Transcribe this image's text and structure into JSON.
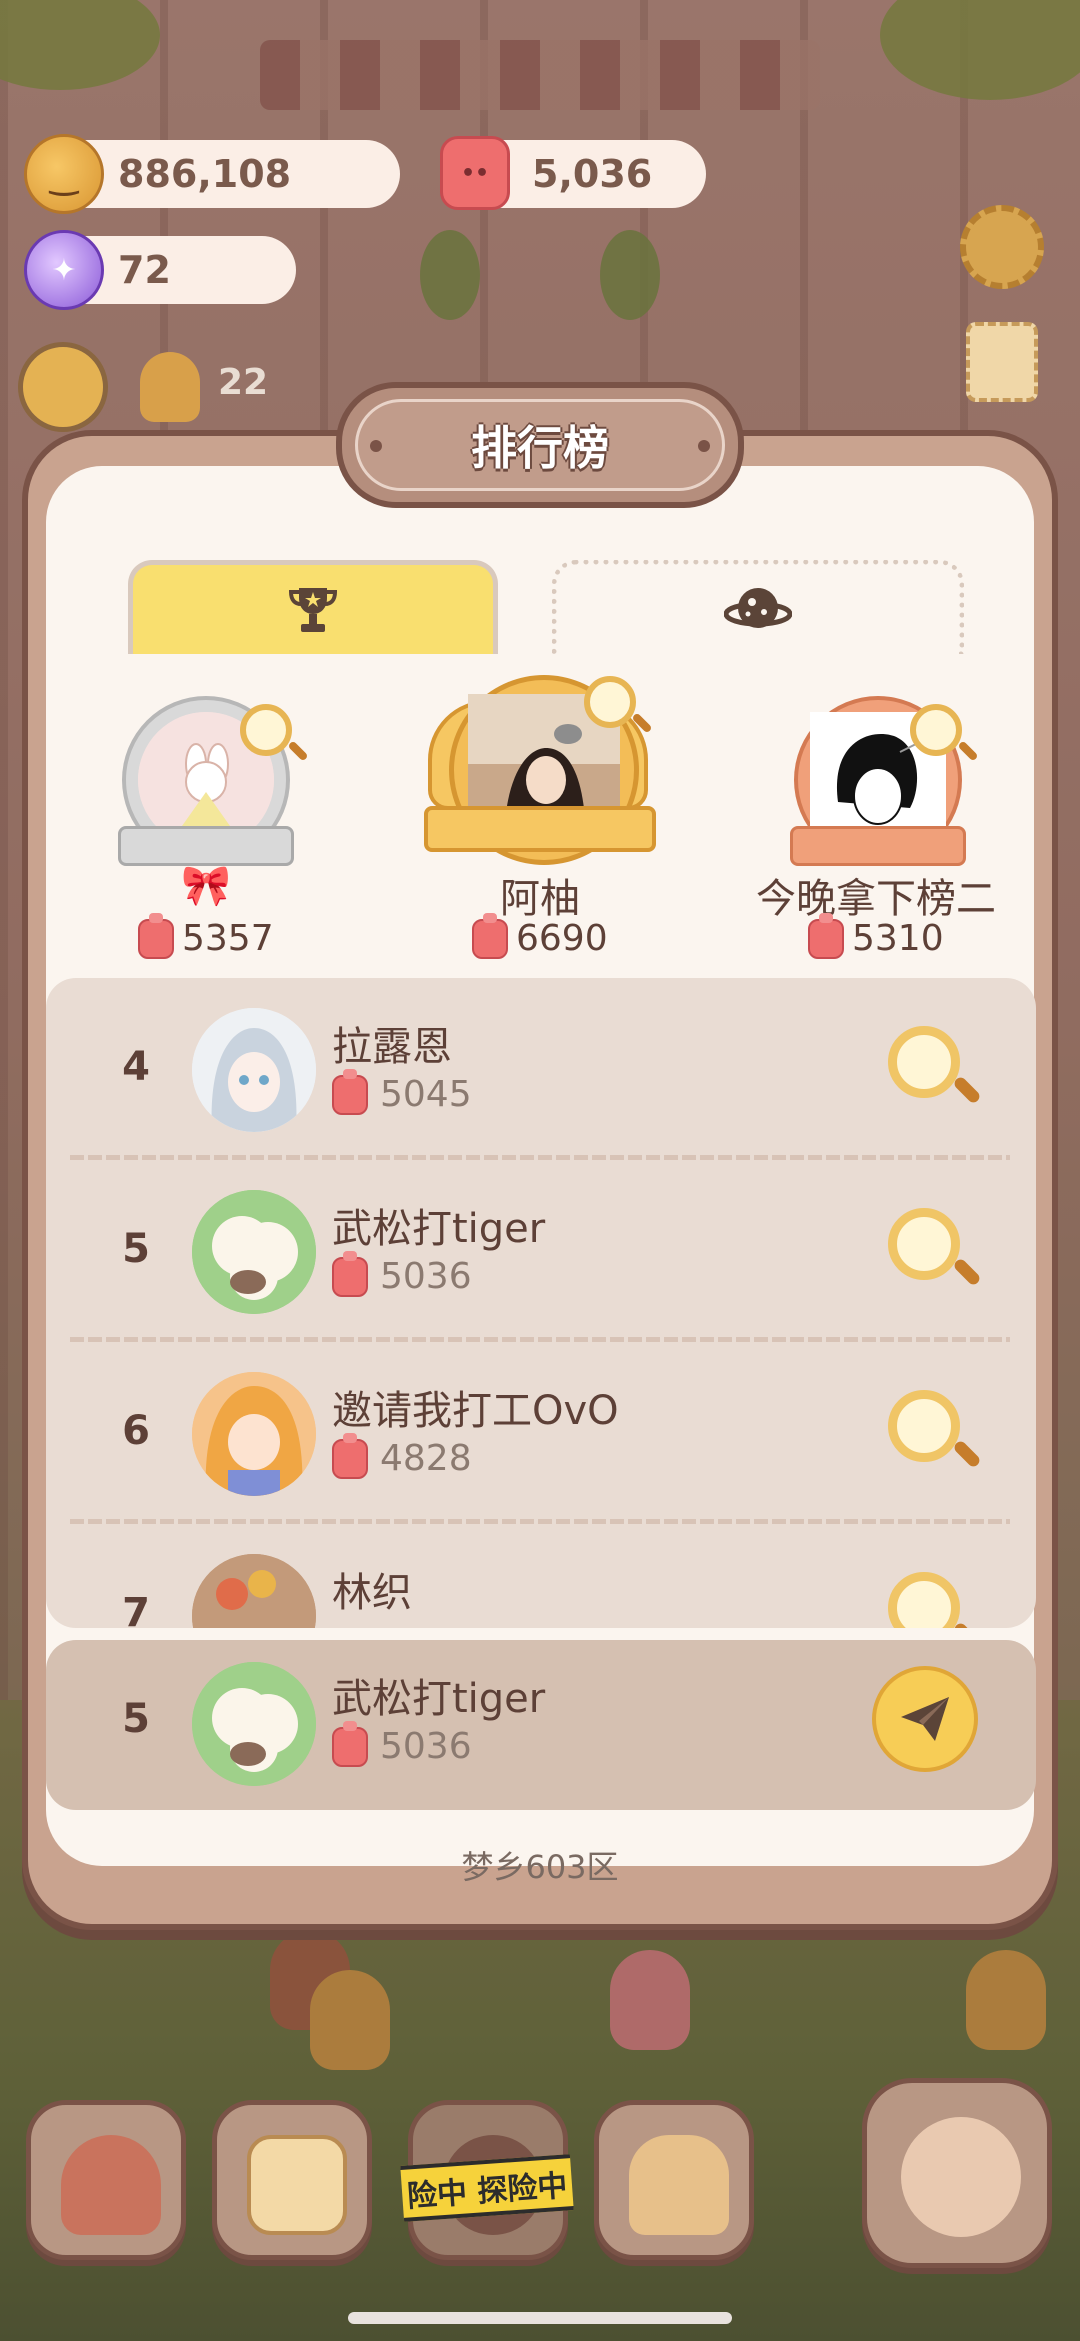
{
  "resources": {
    "cookies": "886,108",
    "candy": "5,036",
    "gems": "72",
    "gingers": "22"
  },
  "modal": {
    "title": "排行榜",
    "tabs": [
      {
        "icon": "trophy-icon",
        "active": true
      },
      {
        "icon": "planet-icon",
        "active": false
      }
    ],
    "podium": [
      {
        "place": 2,
        "name": "🎀",
        "score": "5357"
      },
      {
        "place": 1,
        "name": "阿柚",
        "score": "6690"
      },
      {
        "place": 3,
        "name": "今晚拿下榜二",
        "score": "5310"
      }
    ],
    "list": [
      {
        "rank": "4",
        "name": "拉露恩",
        "score": "5045"
      },
      {
        "rank": "5",
        "name": "武松打tiger",
        "score": "5036"
      },
      {
        "rank": "6",
        "name": "邀请我打工OvO",
        "score": "4828"
      },
      {
        "rank": "7",
        "name": "林织",
        "score": ""
      }
    ],
    "me": {
      "rank": "5",
      "name": "武松打tiger",
      "score": "5036"
    },
    "server": "梦乡603区"
  },
  "bottom_bar": {
    "adventure_label": "险中 探险中"
  },
  "colors": {
    "tab_active": "#f9df6f",
    "send_button": "#f7cd56",
    "list_bg": "#e9dcd3",
    "modal_frame": "#7a5347"
  }
}
